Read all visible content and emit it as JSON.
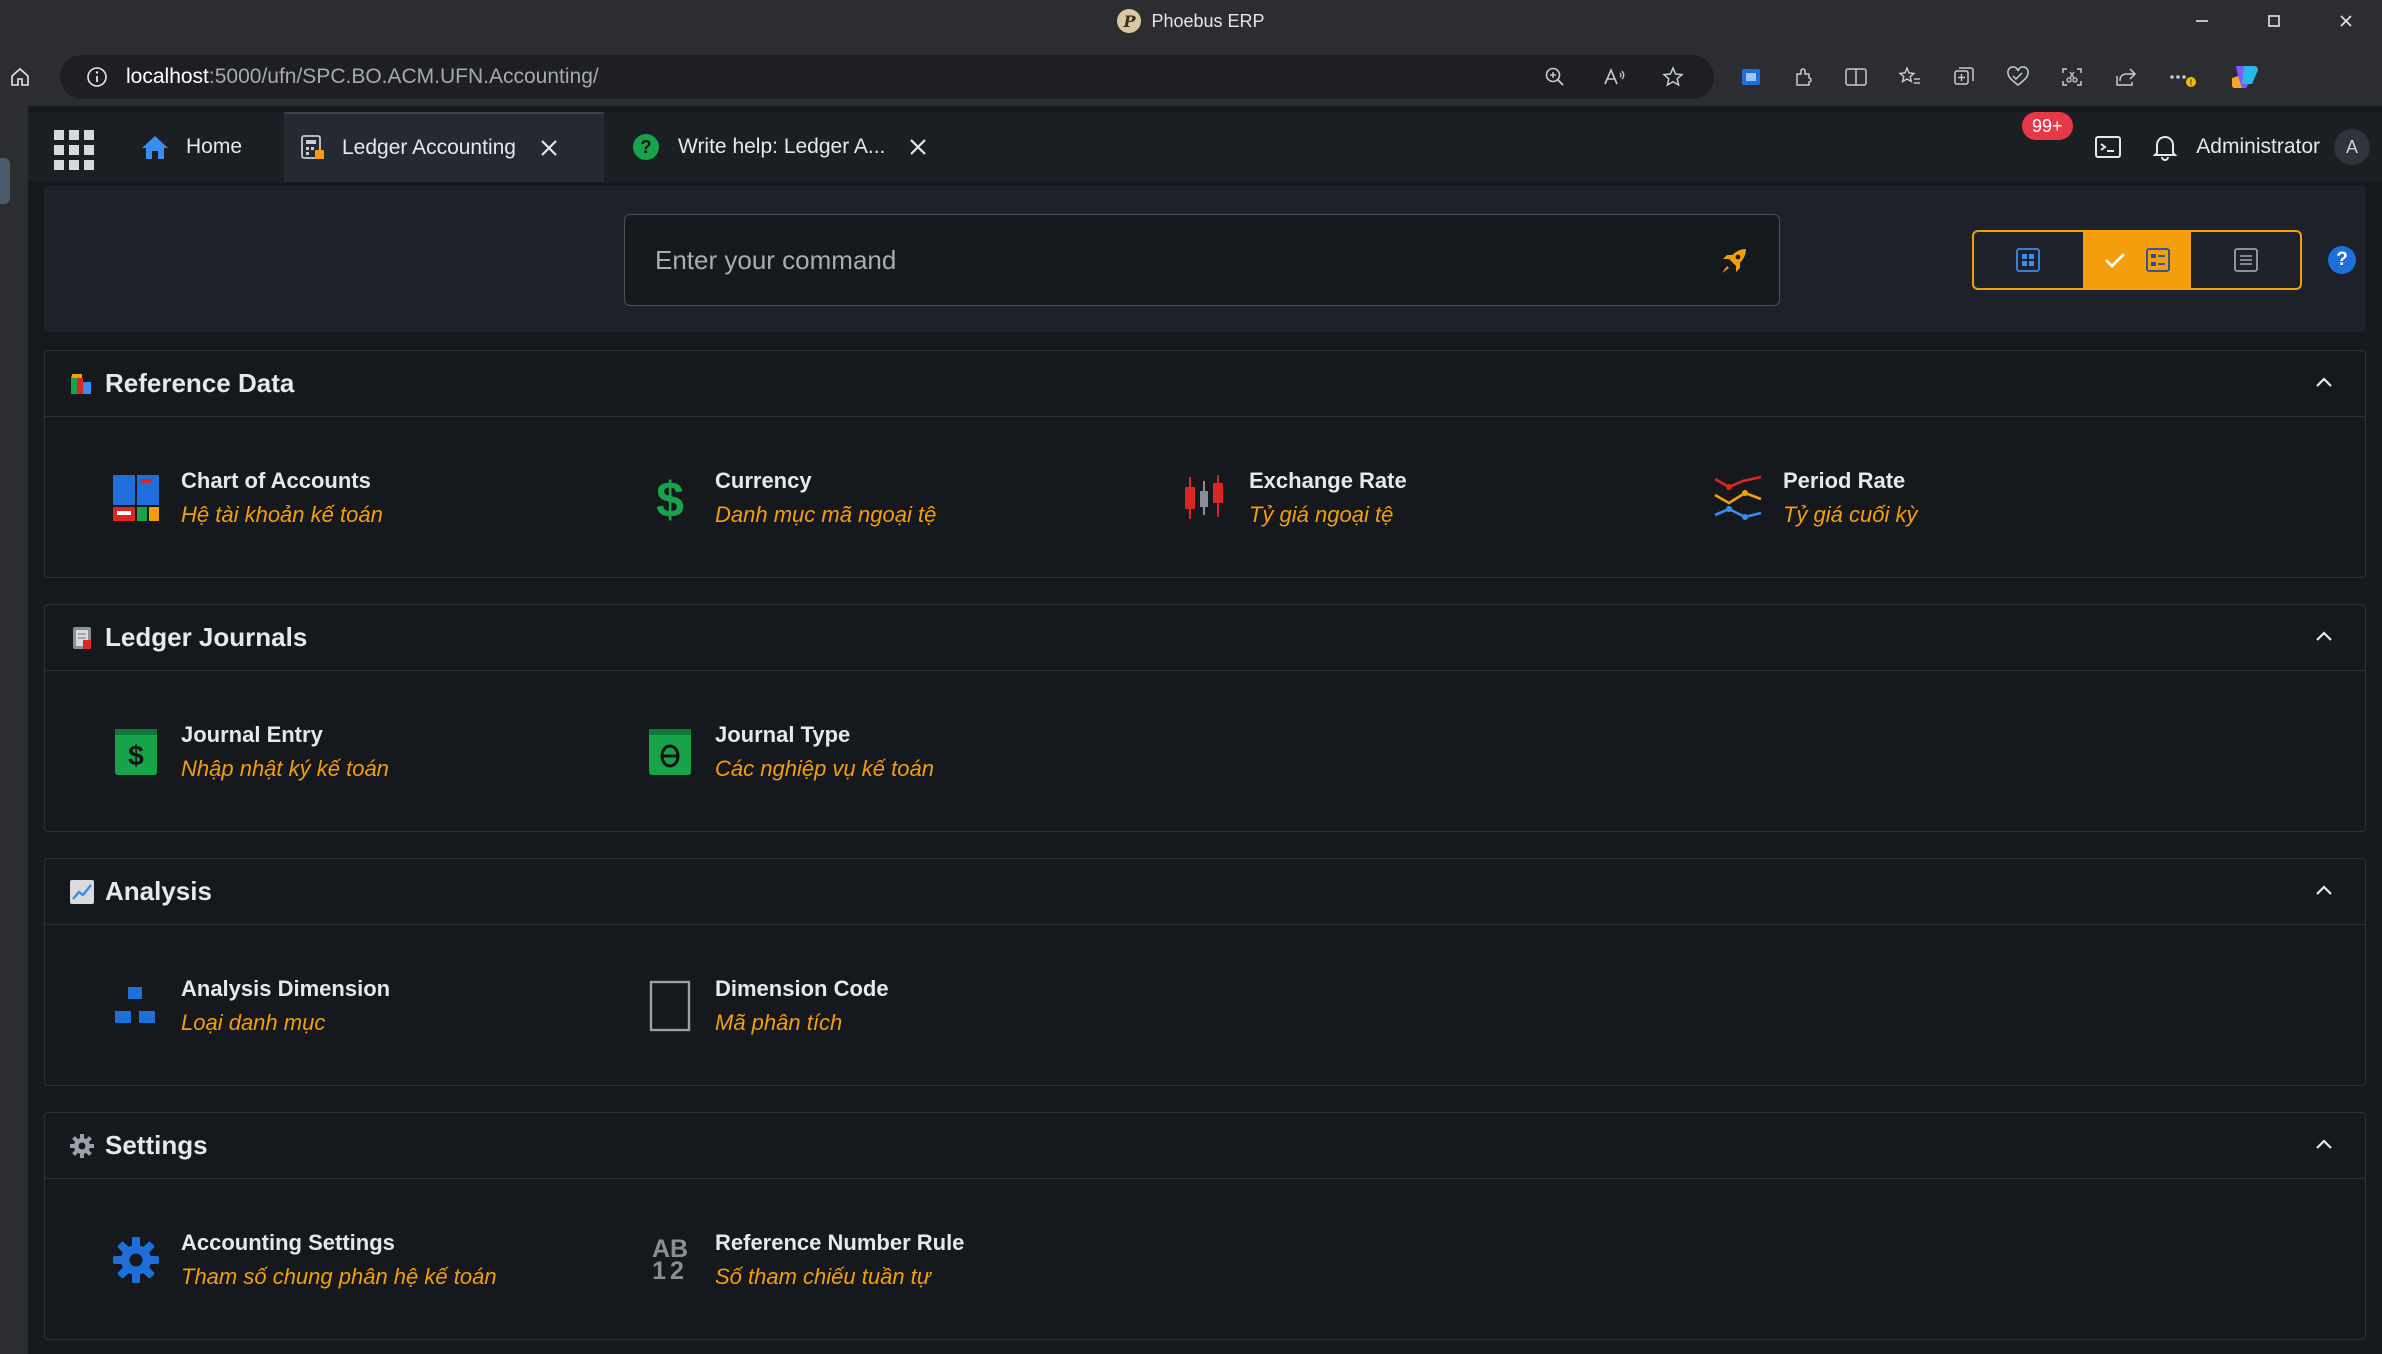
{
  "window": {
    "title": "Phoebus ERP"
  },
  "browser": {
    "url_host": "localhost",
    "url_path": ":5000/ufn/SPC.BO.ACM.UFN.Accounting/"
  },
  "tabs": [
    {
      "label": "Home"
    },
    {
      "label": "Ledger Accounting"
    },
    {
      "label": "Write help: Ledger A..."
    }
  ],
  "header": {
    "notification_count": "99+",
    "user_name": "Administrator",
    "user_initial": "A"
  },
  "command": {
    "placeholder": "Enter your command"
  },
  "sections": [
    {
      "title": "Reference Data",
      "items": [
        {
          "name": "Chart of Accounts",
          "desc": "Hệ tài khoản kế toán"
        },
        {
          "name": "Currency",
          "desc": "Danh mục mã ngoại tệ"
        },
        {
          "name": "Exchange Rate",
          "desc": "Tỷ giá ngoại tệ"
        },
        {
          "name": "Period Rate",
          "desc": "Tỷ giá cuối kỳ"
        }
      ]
    },
    {
      "title": "Ledger Journals",
      "items": [
        {
          "name": "Journal Entry",
          "desc": "Nhập nhật ký kế toán"
        },
        {
          "name": "Journal Type",
          "desc": "Các nghiệp vụ kế toán"
        }
      ]
    },
    {
      "title": "Analysis",
      "items": [
        {
          "name": "Analysis Dimension",
          "desc": "Loại danh mục"
        },
        {
          "name": "Dimension Code",
          "desc": "Mã phân tích"
        }
      ]
    },
    {
      "title": "Settings",
      "items": [
        {
          "name": "Accounting Settings",
          "desc": "Tham số chung phân hệ kế toán"
        },
        {
          "name": "Reference Number Rule",
          "desc": "Số tham chiếu tuần tự"
        }
      ]
    }
  ],
  "icons": {
    "ab_top": "AB",
    "ab_bottom": "12",
    "help": "?"
  },
  "colors": {
    "accent": "#f59e0b",
    "blue": "#1e6fd9",
    "green": "#16a34a",
    "red": "#dc2626"
  }
}
